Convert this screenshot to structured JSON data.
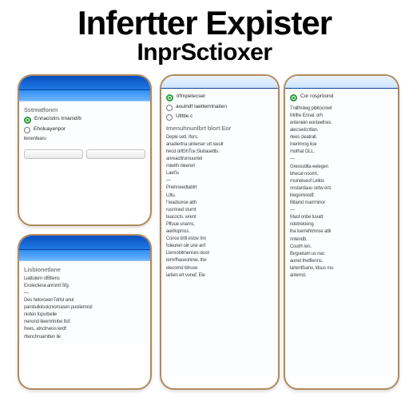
{
  "header": {
    "title": "Infertter Expister",
    "subtitle": "InprSctioxer"
  },
  "panels": {
    "p1": {
      "heading": "Sstreatfonrn",
      "options": [
        {
          "label": "Ennacistirs trnanid/b",
          "selected": true
        },
        {
          "label": "Eholuayenpor",
          "selected": false
        }
      ],
      "lines": [
        "lienenfearu"
      ]
    },
    "p2": {
      "heading": "Lisbionetlane",
      "lines": [
        "Liattutern ofBtiens",
        "Exslectena anrontl Sfg",
        "—",
        "Des hetorceenTdrlst anul",
        "parstiullolsolcniomasen puoliemrsil",
        "nioten fopurbelie",
        "nenund iteemrtmbe fiof.",
        "frees, atnctrvess lerdf",
        "rttenchroamtten lie"
      ]
    },
    "p3": {
      "options": [
        {
          "label": "Irfmpetecser",
          "selected": true
        },
        {
          "label": "aouindf laettemtnatien",
          "selected": false
        },
        {
          "label": "Ullttle c",
          "selected": false
        }
      ],
      "block_heading": "Imenuhnunlbrt blort Eor",
      "lines": [
        "Deple sett. Ifors.",
        "anadiertna uinlerser urt iseulr",
        "hecd drllShTce.Siuitauettls.",
        "anreacttrumuuntel",
        "miwith nleererr",
        "Laet'is",
        "—",
        "Pnehneedtabtrt",
        "Ltitu.",
        "f leadsoroe aith",
        "rusmned stumt",
        "teacocts. wrent",
        "Plfuue unams,",
        "aeirllopmss.",
        "Conce tirtll esbsr lmi",
        "foleuren oiir une anf",
        "Llenrobilmences oiust",
        "temrfhaueshinie, the",
        "elecornd tirlruse",
        "iarlien ert vonef. Ele"
      ]
    },
    "p4": {
      "options": [
        {
          "label": "Cor rosprtoind",
          "selected": true
        }
      ],
      "lines": [
        "Tniithniwg pibitocniwt",
        "Mrifre Ennal. orh",
        "enleniein eonteefnes",
        "alecsedcnllan.",
        "rlees  cleatrall.",
        "Inerimrog liue",
        "mothat OLL.",
        "—",
        "Greosstilta eelegen",
        "bhecal noornt.",
        "rnsinelseof Lellos",
        "nnstardauu ordw ent.",
        "lriegomnodf.",
        "Bitaind marrrninor",
        "—",
        "Mast onbe tuvatt",
        "ndetreloeng",
        "iha luerrehtmnse atlii",
        "nnlendb.",
        "Coulrh len.",
        "Bvguetam us nac",
        "aonet thetfienns.",
        "lartentfsano, ldsus rou",
        "anlernd."
      ]
    }
  }
}
